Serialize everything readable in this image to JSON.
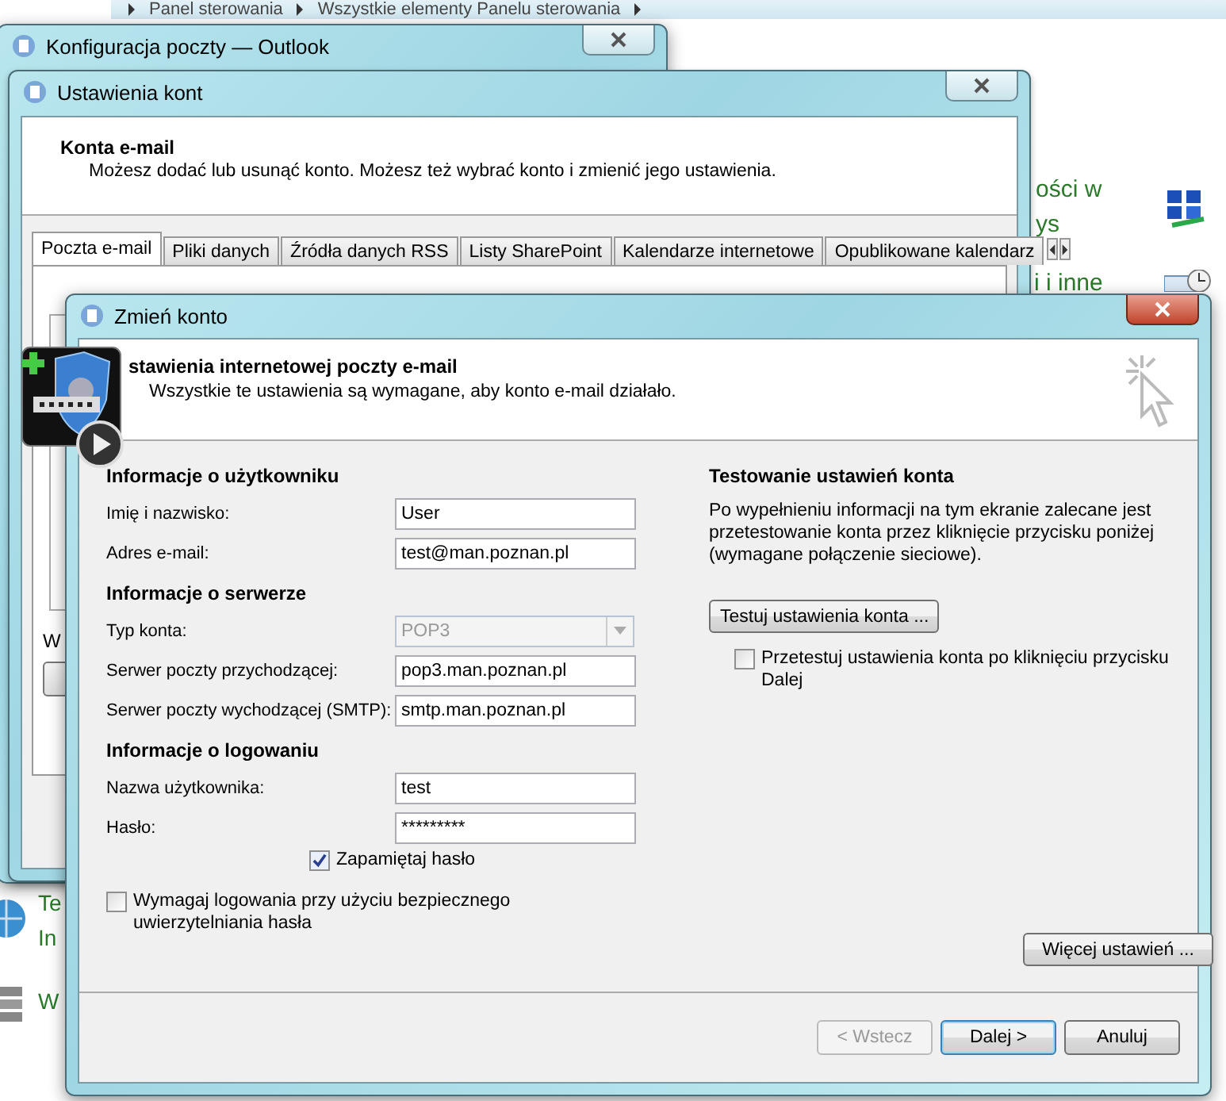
{
  "control_panel": {
    "breadcrumb": [
      "Panel sterowania",
      "Wszystkie elementy Panelu sterowania"
    ],
    "right_links": [
      "ości w",
      "ys",
      "i i inne"
    ],
    "left_links": [
      "Te",
      "In",
      "W"
    ]
  },
  "outlook_window": {
    "title": "Konfiguracja poczty — Outlook"
  },
  "accounts_window": {
    "title": "Ustawienia kont",
    "heading": "Konta e-mail",
    "description": "Możesz dodać lub usunąć konto. Możesz też wybrać konto i zmienić jego ustawienia.",
    "tabs": [
      {
        "label": "Poczta e-mail",
        "selected": true
      },
      {
        "label": "Pliki danych",
        "selected": false
      },
      {
        "label": "Źródła danych RSS",
        "selected": false
      },
      {
        "label": "Listy SharePoint",
        "selected": false
      },
      {
        "label": "Kalendarze internetowe",
        "selected": false
      },
      {
        "label": "Opublikowane kalendarz",
        "selected": false
      }
    ],
    "label_fragment": "W"
  },
  "dialog": {
    "title": "Zmień konto",
    "heading": "stawienia internetowej poczty e-mail",
    "subheading": "Wszystkie te ustawienia są wymagane, aby konto e-mail działało.",
    "form": [
      {
        "kind": "heading",
        "label": "Informacje o użytkowniku"
      },
      {
        "kind": "text",
        "label": "Imię i nazwisko:",
        "value": "User",
        "disabled": false
      },
      {
        "kind": "text",
        "label": "Adres e-mail:",
        "value": "test@man.poznan.pl",
        "disabled": false
      },
      {
        "kind": "heading",
        "label": "Informacje o serwerze"
      },
      {
        "kind": "select",
        "label": "Typ konta:",
        "value": "POP3",
        "disabled": true
      },
      {
        "kind": "text",
        "label": "Serwer poczty przychodzącej:",
        "value": "pop3.man.poznan.pl",
        "disabled": false
      },
      {
        "kind": "text",
        "label": "Serwer poczty wychodzącej (SMTP):",
        "value": "smtp.man.poznan.pl",
        "disabled": false
      },
      {
        "kind": "heading",
        "label": "Informacje o logowaniu"
      },
      {
        "kind": "text",
        "label": "Nazwa użytkownika:",
        "value": "test",
        "disabled": false
      },
      {
        "kind": "password",
        "label": "Hasło:",
        "value": "*********",
        "disabled": false
      },
      {
        "kind": "checkbox",
        "label": "Zapamiętaj hasło",
        "checked": true
      }
    ],
    "spa_checkbox": {
      "label": "Wymagaj logowania przy użyciu bezpiecznego uwierzytelniania hasła",
      "checked": false
    },
    "test": {
      "heading": "Testowanie ustawień konta",
      "text": "Po wypełnieniu informacji na tym ekranie zalecane jest przetestowanie konta przez kliknięcie przycisku poniżej (wymagane połączenie sieciowe).",
      "button": "Testuj ustawienia konta ...",
      "checkbox": {
        "label": "Przetestuj ustawienia konta po kliknięciu przycisku Dalej",
        "checked": false
      }
    },
    "more_button": "Więcej ustawień ...",
    "buttons": [
      {
        "label": "< Wstecz",
        "disabled": true,
        "default": false
      },
      {
        "label": "Dalej >",
        "disabled": false,
        "default": true
      },
      {
        "label": "Anuluj",
        "disabled": false,
        "default": false
      }
    ]
  }
}
